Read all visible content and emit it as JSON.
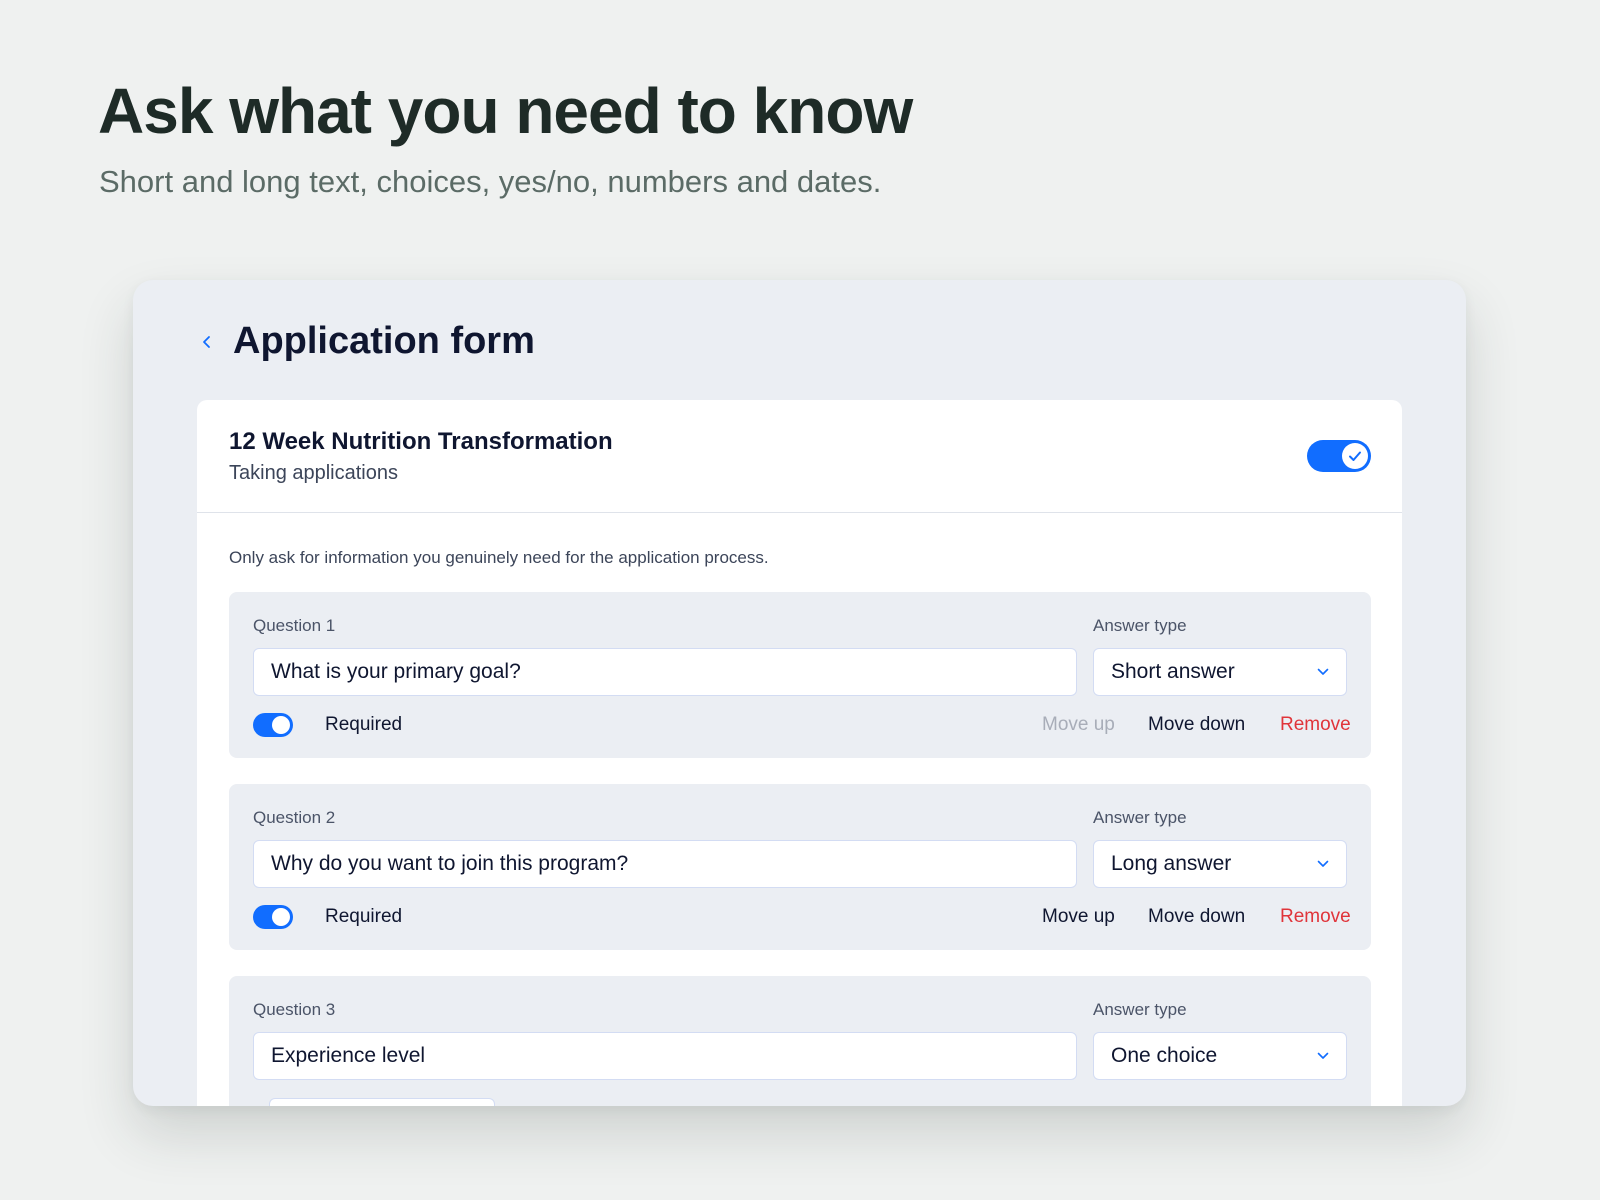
{
  "hero": {
    "title": "Ask what you need to know",
    "subtitle": "Short and long text, choices, yes/no, numbers and dates."
  },
  "form": {
    "title": "Application form",
    "back_icon": "chevron-left-icon",
    "accent_color": "#116dff",
    "danger_color": "#e0343a"
  },
  "program": {
    "name": "12 Week Nutrition Transformation",
    "status": "Taking applications",
    "accepting_toggle": "on"
  },
  "hint": "Only ask for information you genuinely need for the application process.",
  "questions": [
    {
      "label": "Question 1",
      "value": "What is your primary goal?",
      "answer_type_label": "Answer type",
      "answer_type": "Short answer",
      "required_label": "Required",
      "required": true,
      "move_up": "Move up",
      "move_up_disabled": true,
      "move_down": "Move down",
      "remove": "Remove"
    },
    {
      "label": "Question 2",
      "value": "Why do you want to join this program?",
      "answer_type_label": "Answer type",
      "answer_type": "Long answer",
      "required_label": "Required",
      "required": true,
      "move_up": "Move up",
      "move_up_disabled": false,
      "move_down": "Move down",
      "remove": "Remove"
    },
    {
      "label": "Question 3",
      "value": "Experience level",
      "answer_type_label": "Answer type",
      "answer_type": "One choice"
    }
  ]
}
